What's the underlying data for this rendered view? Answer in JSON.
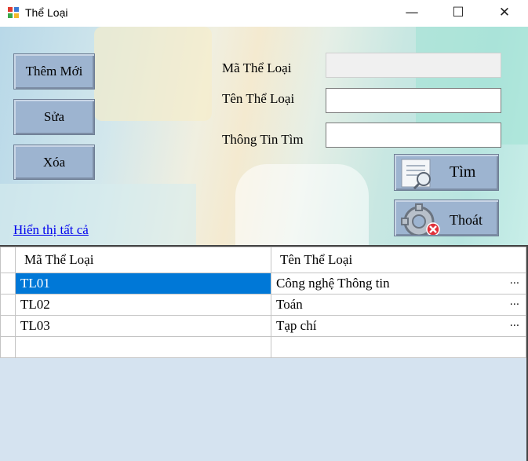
{
  "window": {
    "title": "Thể Loại",
    "minimize_glyph": "—",
    "maximize_glyph": "☐",
    "close_glyph": "✕",
    "icon": "form-icon"
  },
  "buttons": {
    "add": "Thêm Mới",
    "edit": "Sửa",
    "delete": "Xóa",
    "search": "Tìm",
    "exit": "Thoát",
    "search_icon": "document-magnifier-icon",
    "exit_icon": "gear-close-icon"
  },
  "link": {
    "show_all": "Hiển thị tất cả"
  },
  "form": {
    "ma_label": "Mã Thể Loại",
    "ma_value": "",
    "ten_label": "Tên Thể Loại",
    "ten_value": "",
    "thongtin_label": "Thông Tin Tìm",
    "thongtin_value": ""
  },
  "grid": {
    "columns": [
      "Mã Thể Loại",
      "Tên Thể Loại"
    ],
    "rows": [
      {
        "ma": "TL01",
        "ten": "Công nghệ Thông tin",
        "more": "...",
        "selected": true
      },
      {
        "ma": "TL02",
        "ten": "Toán",
        "more": "..."
      },
      {
        "ma": "TL03",
        "ten": "Tạp chí",
        "more": "..."
      }
    ],
    "selection_color": "#0078d7",
    "background_color": "#d5e3f0"
  }
}
